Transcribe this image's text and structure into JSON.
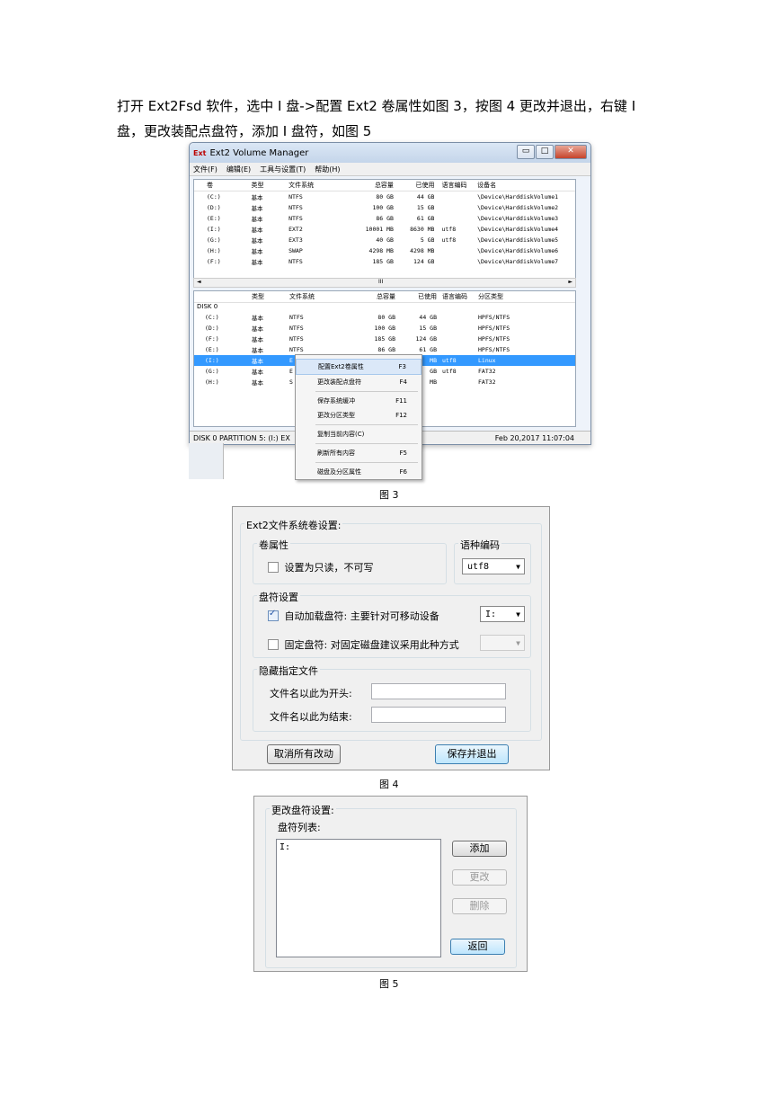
{
  "intro": {
    "text": "打开 Ext2Fsd 软件，选中 I 盘->配置 Ext2 卷属性如图 3，按图 4 更改并退出，右键 I 盘，更改装配点盘符，添加 I 盘符，如图 5"
  },
  "fig3": {
    "title": "Ext2 Volume Manager",
    "logo": "Ext",
    "controls": {
      "min": "▭",
      "max": "□",
      "close": "✕"
    },
    "menu": [
      "文件(F)",
      "编辑(E)",
      "工具与设置(T)",
      "帮助(H)"
    ],
    "top_headers": [
      "卷",
      "类型",
      "文件系统",
      "总容量",
      "已使用",
      "语言编码",
      "设备名"
    ],
    "top_rows": [
      [
        "(C:)",
        "基本",
        "NTFS",
        "80 GB",
        "44 GB",
        "",
        "\\Device\\HarddiskVolume1"
      ],
      [
        "(D:)",
        "基本",
        "NTFS",
        "100 GB",
        "15 GB",
        "",
        "\\Device\\HarddiskVolume2"
      ],
      [
        "(E:)",
        "基本",
        "NTFS",
        "86 GB",
        "61 GB",
        "",
        "\\Device\\HarddiskVolume3"
      ],
      [
        "(I:)",
        "基本",
        "EXT2",
        "10001 MB",
        "8630 MB",
        "utf8",
        "\\Device\\HarddiskVolume4"
      ],
      [
        "(G:)",
        "基本",
        "EXT3",
        "40 GB",
        "5 GB",
        "utf8",
        "\\Device\\HarddiskVolume5"
      ],
      [
        "(H:)",
        "基本",
        "SWAP",
        "4298 MB",
        "4298 MB",
        "",
        "\\Device\\HarddiskVolume6"
      ],
      [
        "(F:)",
        "基本",
        "NTFS",
        "185 GB",
        "124 GB",
        "",
        "\\Device\\HarddiskVolume7"
      ]
    ],
    "scroll": {
      "left": "◄",
      "mid": "III",
      "right": "►"
    },
    "bottom_headers": [
      "",
      "类型",
      "文件系统",
      "总容量",
      "已使用",
      "语言编码",
      "分区类型"
    ],
    "disk_label": "DISK 0",
    "bottom_rows": [
      [
        "(C:)",
        "基本",
        "NTFS",
        "80 GB",
        "44 GB",
        "",
        "HPFS/NTFS"
      ],
      [
        "(D:)",
        "基本",
        "NTFS",
        "100 GB",
        "15 GB",
        "",
        "HPFS/NTFS"
      ],
      [
        "(F:)",
        "基本",
        "NTFS",
        "185 GB",
        "124 GB",
        "",
        "HPFS/NTFS"
      ],
      [
        "(E:)",
        "基本",
        "NTFS",
        "86 GB",
        "61 GB",
        "",
        "HPFS/NTFS"
      ],
      [
        "(I:)",
        "基本",
        "E",
        "",
        "MB",
        "utf8",
        "Linux"
      ],
      [
        "(G:)",
        "基本",
        "E",
        "",
        "GB",
        "utf8",
        "FAT32"
      ],
      [
        "(H:)",
        "基本",
        "S",
        "",
        "MB",
        "",
        "FAT32"
      ]
    ],
    "selected_row_index": 4,
    "status_left": "DISK 0 PARTITION 5: (I:) EX",
    "status_right": "Feb 20,2017 11:07:04",
    "context_menu": [
      {
        "label": "配置Ext2卷属性",
        "key": "F3"
      },
      {
        "label": "更改装配点盘符",
        "key": "F4"
      },
      {
        "label": "保存系统缓冲",
        "key": "F11"
      },
      {
        "label": "更改分区类型",
        "key": "F12"
      },
      {
        "label": "复制当前内容(C)",
        "key": ""
      },
      {
        "label": "刷新所有内容",
        "key": "F5"
      },
      {
        "label": "磁盘及分区属性",
        "key": "F6"
      }
    ],
    "caption": "图 3"
  },
  "fig4": {
    "frame_title": "Ext2文件系统卷设置:",
    "vol_props_title": "卷属性",
    "readonly_label": "设置为只读，不可写",
    "readonly_checked": false,
    "codepage_title": "语种编码",
    "codepage_value": "utf8",
    "mount_title": "盘符设置",
    "auto_mount_label": "自动加载盘符: 主要针对可移动设备",
    "auto_mount_checked": true,
    "auto_mount_value": "I:",
    "fixed_label": "固定盘符: 对固定磁盘建议采用此种方式",
    "fixed_checked": false,
    "fixed_value": "",
    "hide_title": "隐藏指定文件",
    "prefix_label": "文件名以此为开头:",
    "suffix_label": "文件名以此为结束:",
    "cancel_button": "取消所有改动",
    "save_button": "保存并退出",
    "dropdown_arrow": "▼",
    "caption": "图 4"
  },
  "fig5": {
    "frame_title": "更改盘符设置:",
    "list_title": "盘符列表:",
    "list_items": [
      "I:"
    ],
    "add_button": "添加",
    "change_button": "更改",
    "delete_button": "删除",
    "back_button": "返回",
    "caption": "图 5"
  }
}
